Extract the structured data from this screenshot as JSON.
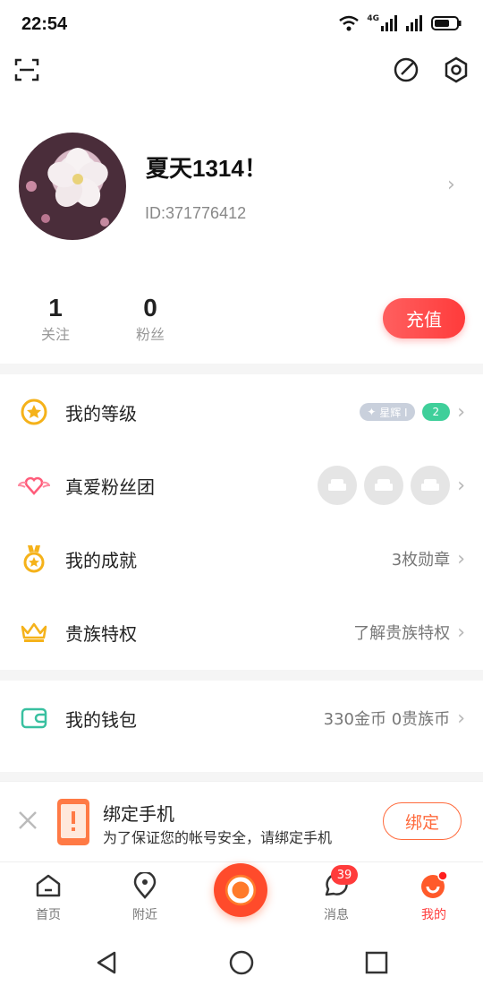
{
  "status_bar": {
    "time": "22:54",
    "network": "4G"
  },
  "profile": {
    "name": "夏天1314！",
    "id_text": "ID:371776412",
    "stats": [
      {
        "value": "1",
        "label": "关注"
      },
      {
        "value": "0",
        "label": "粉丝"
      }
    ],
    "recharge_label": "充值"
  },
  "menu": [
    {
      "label": "我的等级",
      "icon": "star-medal-icon",
      "badge_text": "星辉 I",
      "level": "2"
    },
    {
      "label": "真爱粉丝团",
      "icon": "heart-wings-icon",
      "seats": 3
    },
    {
      "label": "我的成就",
      "icon": "medal-icon",
      "right_text": "3枚勋章"
    },
    {
      "label": "贵族特权",
      "icon": "crown-icon",
      "right_text": "了解贵族特权"
    },
    {
      "label": "我的钱包",
      "icon": "wallet-icon",
      "right_text": "330金币 0贵族币"
    }
  ],
  "bind_banner": {
    "title": "绑定手机",
    "subtitle": "为了保证您的帐号安全，请绑定手机",
    "button_label": "绑定"
  },
  "tabs": [
    {
      "label": "首页",
      "icon": "home-icon"
    },
    {
      "label": "附近",
      "icon": "location-icon"
    },
    {
      "label": "消息",
      "icon": "message-icon",
      "badge": "39"
    },
    {
      "label": "我的",
      "icon": "profile-icon"
    }
  ],
  "colors": {
    "accent": "#ff5a3c",
    "gold": "#f5b21a",
    "teal": "#39c0a0"
  }
}
